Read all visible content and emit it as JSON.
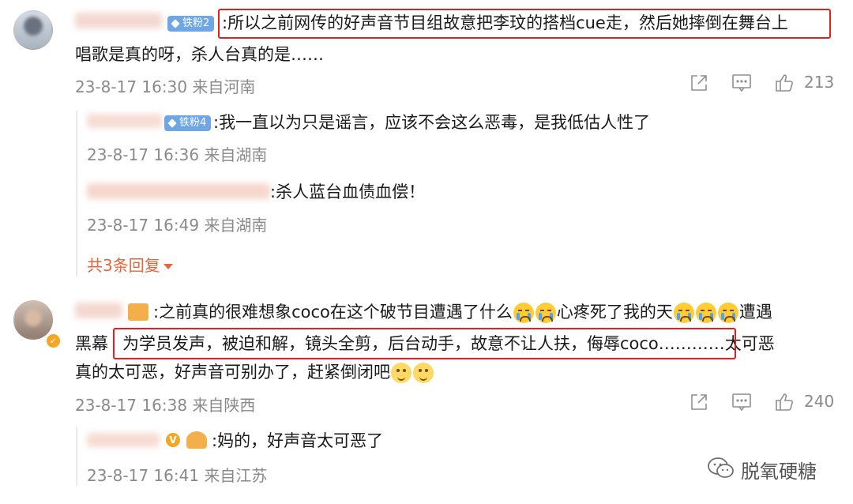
{
  "comments": [
    {
      "badge": "铁粉2",
      "text_line1": ":所以之前网传的好声音节目组故意把李玟的搭档cue走，然后她摔倒在舞台上",
      "text_line2": "唱歌是真的呀，杀人台真的是……",
      "meta": "23-8-17 16:30 来自河南",
      "likes": "213",
      "replies": [
        {
          "badge": "铁粉4",
          "text": ":我一直以为只是谣言，应该不会这么恶毒，是我低估人性了",
          "meta": "23-8-17 16:36 来自湖南"
        },
        {
          "text": ":杀人蓝台血债血偿！",
          "meta": "23-8-17 16:49 来自湖南"
        }
      ],
      "more_replies": "共3条回复"
    },
    {
      "text_line1": ":之前真的很难想象coco在这个破节目遭遇了什么",
      "text_line1b": "心疼死了我的天",
      "text_line1c": "遭遇",
      "text_line2a": "黑幕",
      "text_line2_boxed": "为学员发声，被迫和解，镜头全剪，后台动手，故意不让人扶，侮辱coco………",
      "text_line2b": "…太可恶",
      "text_line3": "真的太可恶，好声音可别办了，赶紧倒闭吧",
      "meta": "23-8-17 16:38 来自陕西",
      "likes": "240",
      "replies": [
        {
          "text": ":妈的，好声音太可恶了",
          "meta": "23-8-17 16:41 来自江苏"
        }
      ]
    }
  ],
  "watermark": {
    "text": "脱氧硬糖",
    "icon": "wechat-icon"
  },
  "colors": {
    "highlight": "#e02020",
    "more_link": "#e8643a",
    "badge": "#6ea6e6",
    "meta": "#8a8a8a"
  }
}
